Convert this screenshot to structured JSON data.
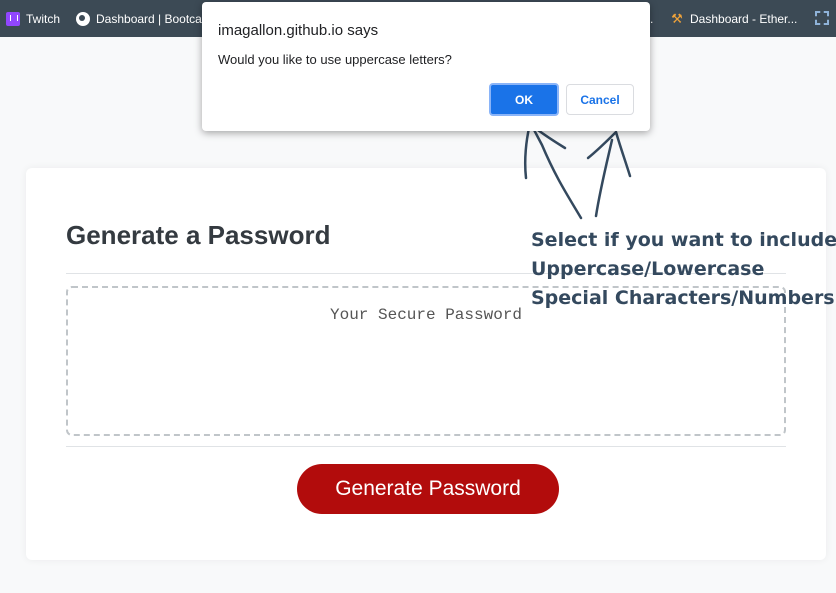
{
  "bookmarks": {
    "items": [
      {
        "label": "Twitch",
        "icon": "twitch-icon"
      },
      {
        "label": "Dashboard | Bootca",
        "icon": "globe-icon"
      },
      {
        "label": ".",
        "icon": ""
      },
      {
        "label": "Dashboard - Ether...",
        "icon": "pickaxe-icon"
      }
    ]
  },
  "dialog": {
    "title": "imagallon.github.io says",
    "message": "Would you like to use uppercase letters?",
    "ok_label": "OK",
    "cancel_label": "Cancel"
  },
  "card": {
    "title": "Generate a Password",
    "password_placeholder": "Your Secure Password",
    "generate_label": "Generate Password"
  },
  "annotation": {
    "lines": [
      "Select if you want to include:",
      "Uppercase/Lowercase",
      "Special Characters/Numbers"
    ]
  },
  "colors": {
    "accent_red": "#b20c0c",
    "dialog_blue": "#1a73e8",
    "bookmark_bar": "#3c4a55",
    "annotation": "#34495e"
  }
}
